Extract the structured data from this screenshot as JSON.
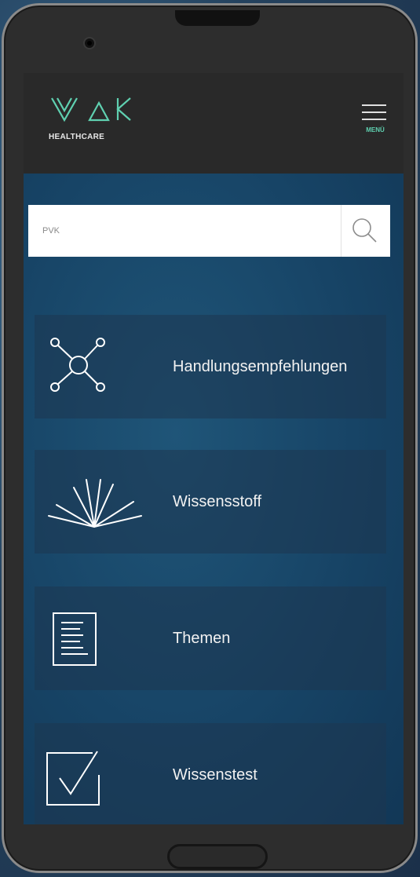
{
  "app": {
    "logo_name": "VAK",
    "logo_sub": "HEALTHCARE",
    "menu_label": "MENÜ"
  },
  "search": {
    "placeholder": "PVK",
    "icon": "search-icon"
  },
  "tiles": [
    {
      "label": "Handlungsempfehlungen",
      "icon": "network-icon"
    },
    {
      "label": "Wissensstoff",
      "icon": "open-book-rays-icon"
    },
    {
      "label": "Themen",
      "icon": "document-icon"
    },
    {
      "label": "Wissenstest",
      "icon": "checkbox-icon"
    }
  ],
  "colors": {
    "accent": "#5fd0b0",
    "header_bg": "#292929",
    "content_bg": "#174466"
  }
}
